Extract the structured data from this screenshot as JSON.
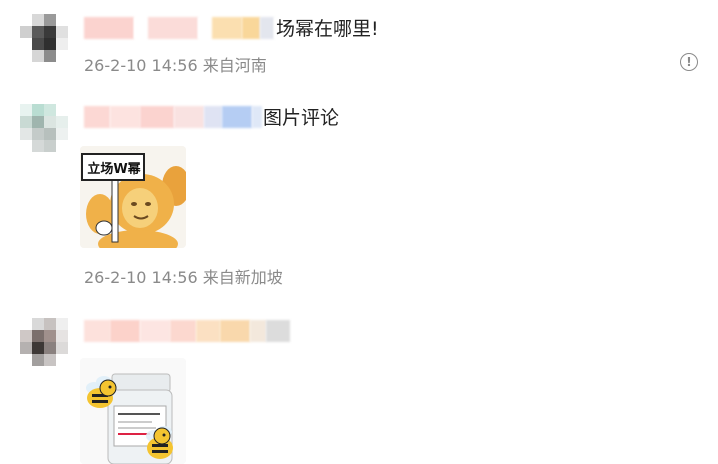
{
  "comments": [
    {
      "text": "场幂在哪里!",
      "meta": "26-2-10 14:56 来自河南",
      "more_icon": "exclamation-circle-icon"
    },
    {
      "text": "图片评论",
      "meta": "26-2-10 14:56 来自新加坡",
      "sticker_caption": "立场W幂"
    },
    {
      "meta": ""
    }
  ]
}
